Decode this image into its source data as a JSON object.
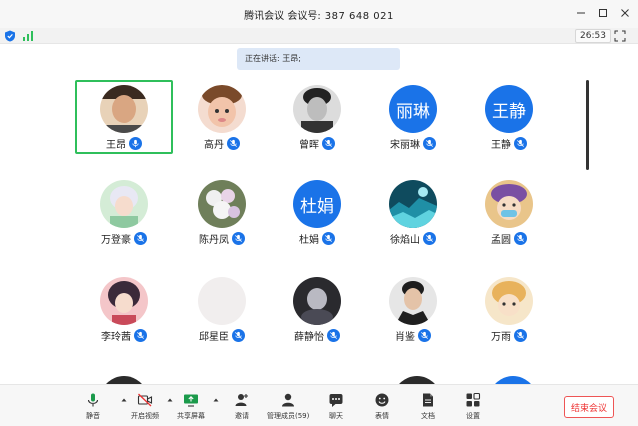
{
  "window": {
    "title": "腾讯会议  会议号:",
    "meeting_number": "387 648 021"
  },
  "status": {
    "timer": "26:53"
  },
  "speaking_banner": "正在讲话: 王昂;",
  "participants": [
    {
      "name": "王昂",
      "avatar": "photo"
    },
    {
      "name": "高丹",
      "avatar": "photo"
    },
    {
      "name": "曾晖",
      "avatar": "photo"
    },
    {
      "name": "宋丽琳",
      "avatar": "text",
      "avatar_text": "丽琳"
    },
    {
      "name": "王静",
      "avatar": "text",
      "avatar_text": "王静"
    },
    {
      "name": "万登豪",
      "avatar": "photo"
    },
    {
      "name": "陈丹凤",
      "avatar": "photo"
    },
    {
      "name": "杜娟",
      "avatar": "text",
      "avatar_text": "杜娟"
    },
    {
      "name": "徐焰山",
      "avatar": "photo"
    },
    {
      "name": "孟圆",
      "avatar": "photo"
    },
    {
      "name": "李玲茜",
      "avatar": "photo"
    },
    {
      "name": "邱星臣",
      "avatar": "photo"
    },
    {
      "name": "薛静怡",
      "avatar": "photo"
    },
    {
      "name": "肖鉴",
      "avatar": "photo"
    },
    {
      "name": "万雨",
      "avatar": "photo"
    }
  ],
  "toolbar": {
    "mute": "静音",
    "video": "开启视频",
    "share": "共享屏幕",
    "invite": "邀请",
    "members": "管理成员(59)",
    "chat": "聊天",
    "reactions": "表情",
    "docs": "文档",
    "settings": "设置",
    "end": "结束会议"
  },
  "colors": {
    "accent_blue": "#1a73e8",
    "active_border": "#2fbf5b",
    "end_red": "#e33333"
  }
}
